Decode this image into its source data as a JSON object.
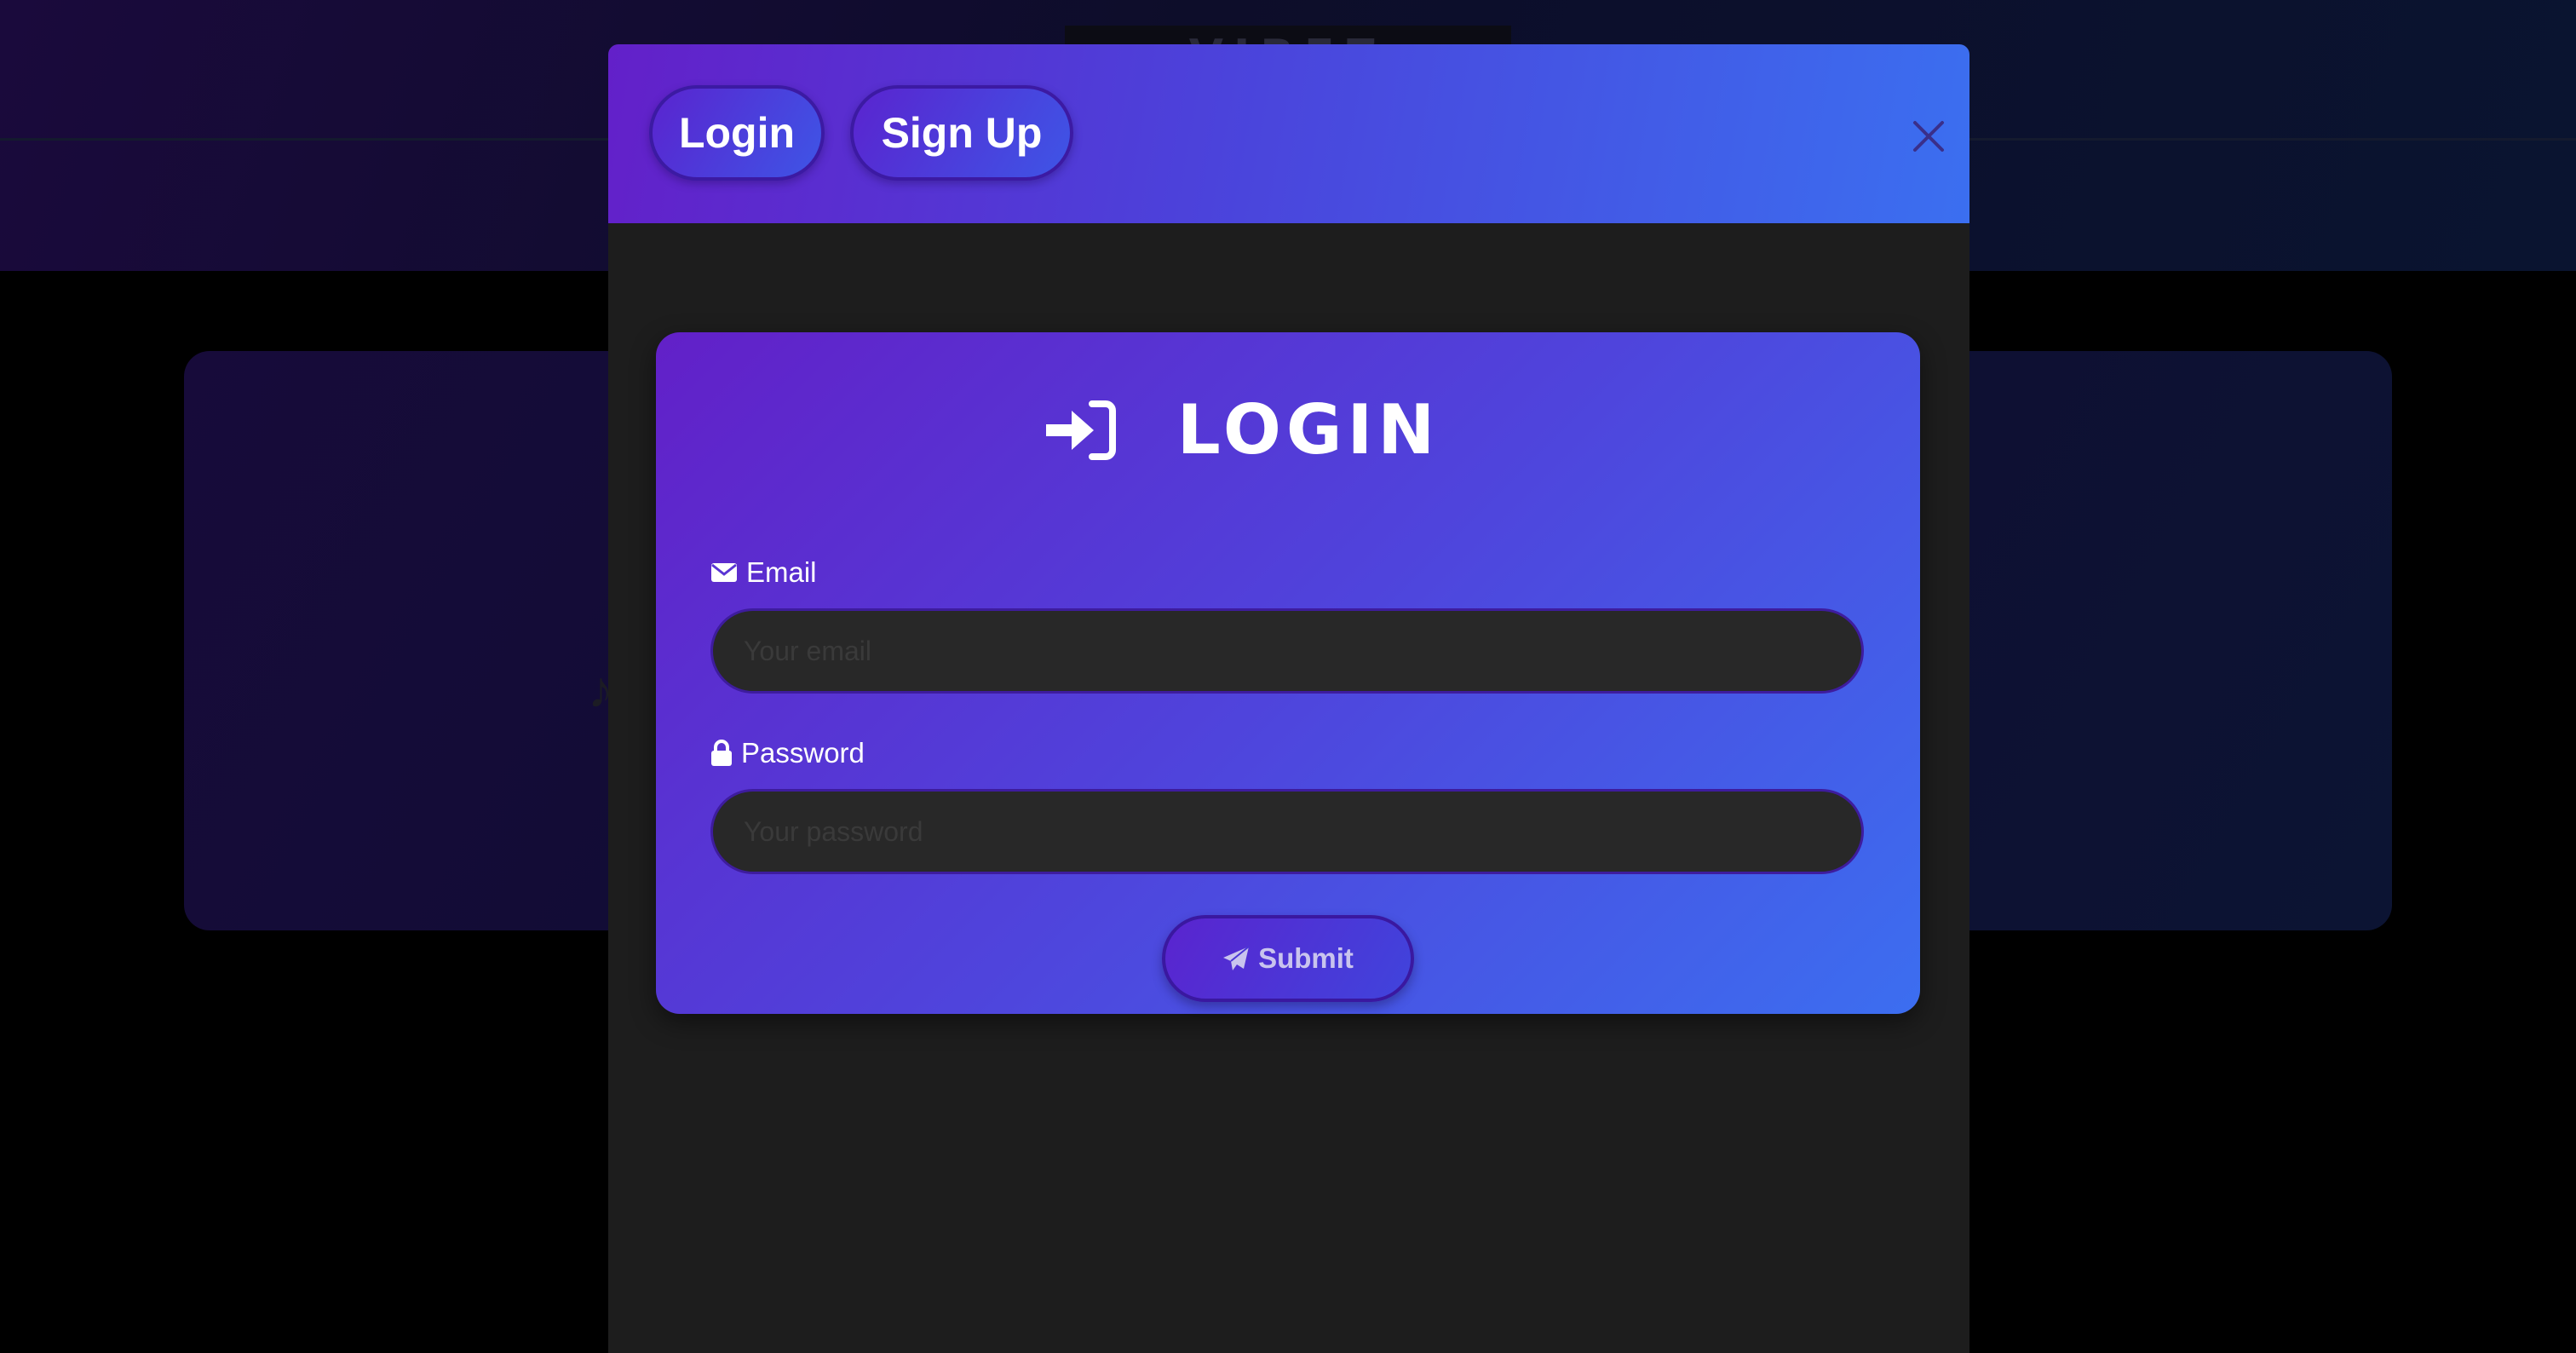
{
  "background": {
    "brand_text": "VIBEZ"
  },
  "modal": {
    "tabs": [
      {
        "label": "Login"
      },
      {
        "label": "Sign Up"
      }
    ],
    "close_icon": "close-icon"
  },
  "login_card": {
    "title": "LOGIN",
    "title_icon": "sign-in-icon",
    "email": {
      "label": "Email",
      "icon": "envelope-icon",
      "placeholder": "Your email",
      "value": ""
    },
    "password": {
      "label": "Password",
      "icon": "lock-icon",
      "placeholder": "Your password",
      "value": ""
    },
    "submit": {
      "label": "Submit",
      "icon": "paper-plane-icon"
    }
  },
  "colors": {
    "gradient_start": "#6320c9",
    "gradient_end": "#3b6ff0",
    "modal_body": "#1d1d1d",
    "input_bg": "#282828"
  }
}
